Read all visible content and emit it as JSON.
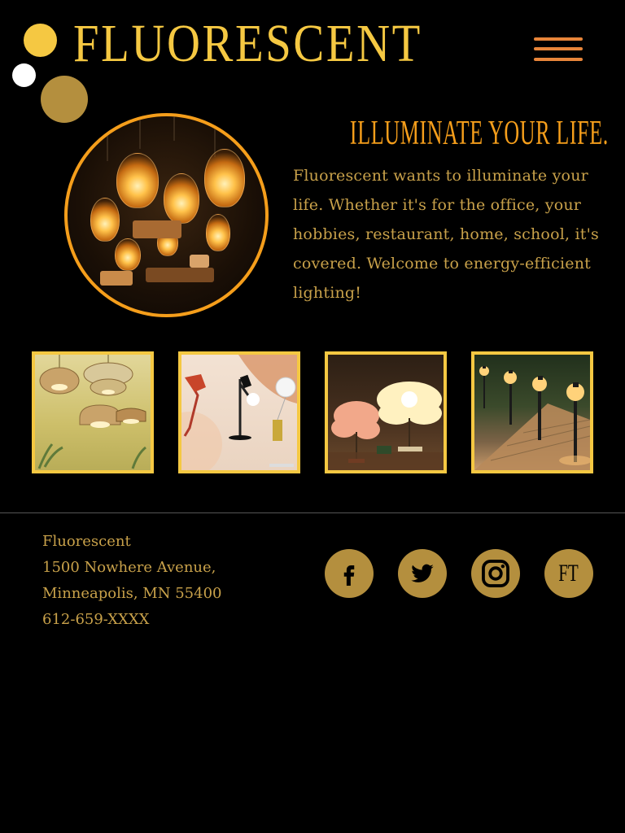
{
  "brand": {
    "name": "FLUORESCENT",
    "logo_dots": [
      "#f5c842",
      "#ffffff",
      "#b48f3e"
    ]
  },
  "header": {
    "menu_icon": "hamburger-menu-icon",
    "menu_color": "#e8853a"
  },
  "hero": {
    "heading": "ILLUMINATE YOUR LIFE.",
    "body": "Fluorescent wants to illuminate your life. Whether it's for the office, your hobbies, restaurant, home, school, it's covered. Welcome to energy-efficient lighting!"
  },
  "gallery": {
    "items": [
      "rattan-pendant-lamps",
      "modern-desk-lamps",
      "feather-table-lamps",
      "solar-path-lights"
    ]
  },
  "footer": {
    "name": "Fluorescent",
    "address_line1": "1500 Nowhere Avenue,",
    "address_line2": "Minneapolis, MN 55400",
    "phone": "612-659-XXXX",
    "social": [
      {
        "icon": "facebook-icon"
      },
      {
        "icon": "twitter-icon"
      },
      {
        "icon": "instagram-icon"
      },
      {
        "icon": "ft-monogram-icon",
        "label": "FT"
      }
    ]
  },
  "colors": {
    "background": "#000000",
    "accent_yellow": "#f5c842",
    "accent_orange": "#f59e1b",
    "text_gold": "#c8a14a",
    "social_bg": "#b48f3e"
  }
}
